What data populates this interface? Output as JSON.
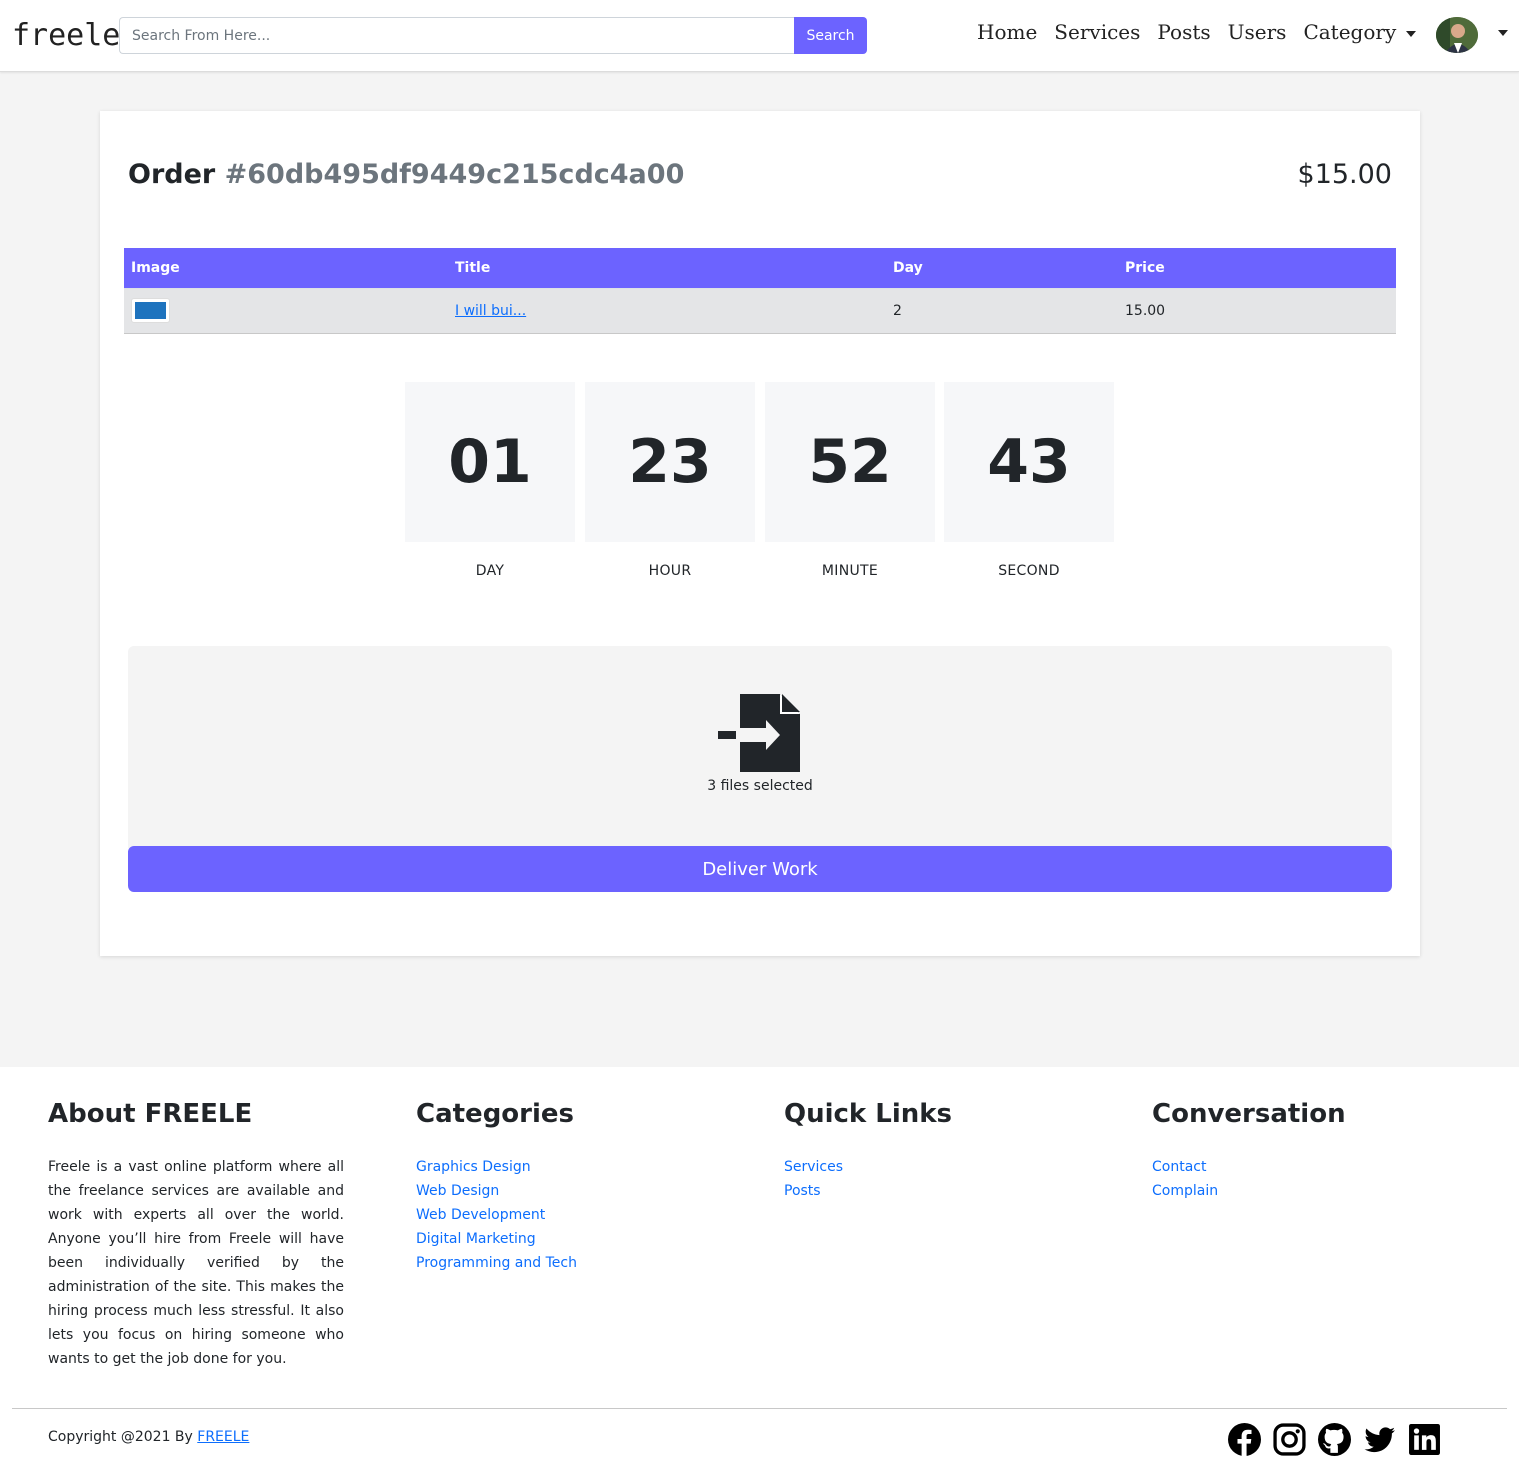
{
  "nav": {
    "brand": "freele",
    "search_placeholder": "Search From Here...",
    "search_button": "Search",
    "links": [
      "Home",
      "Services",
      "Posts",
      "Users"
    ],
    "category_label": "Category"
  },
  "order": {
    "label": "Order",
    "id": "#60db495df9449c215cdc4a00",
    "total": "$15.00"
  },
  "table": {
    "headers": [
      "Image",
      "Title",
      "Day",
      "Price"
    ],
    "rows": [
      {
        "title": "I will bui...",
        "day": "2",
        "price": "15.00"
      }
    ]
  },
  "countdown": {
    "units": [
      {
        "value": "01",
        "label": "DAY"
      },
      {
        "value": "23",
        "label": "HOUR"
      },
      {
        "value": "52",
        "label": "MINUTE"
      },
      {
        "value": "43",
        "label": "SECOND"
      }
    ]
  },
  "upload": {
    "icon": "file-import-icon",
    "status": "3 files selected",
    "button": "Deliver Work"
  },
  "footer": {
    "about": {
      "title": "About FREELE",
      "text": "Freele is a vast online platform where all the freelance services are available and work with experts all over the world. Anyone you’ll hire from Freele will have been individually verified by the administration of the site. This makes the hiring process much less stressful. It also lets you focus on hiring someone who wants to get the job done for you."
    },
    "categories": {
      "title": "Categories",
      "items": [
        "Graphics Design",
        "Web Design",
        "Web Development",
        "Digital Marketing",
        "Programming and Tech"
      ]
    },
    "quick_links": {
      "title": "Quick Links",
      "items": [
        "Services",
        "Posts"
      ]
    },
    "conversation": {
      "title": "Conversation",
      "items": [
        "Contact",
        "Complain"
      ]
    },
    "copyright_prefix": "Copyright @2021 By",
    "copyright_link": "FREELE",
    "socials": [
      "facebook-icon",
      "instagram-icon",
      "github-icon",
      "twitter-icon",
      "linkedin-icon"
    ]
  },
  "colors": {
    "accent": "#6c63ff",
    "link": "#0d6efd"
  }
}
